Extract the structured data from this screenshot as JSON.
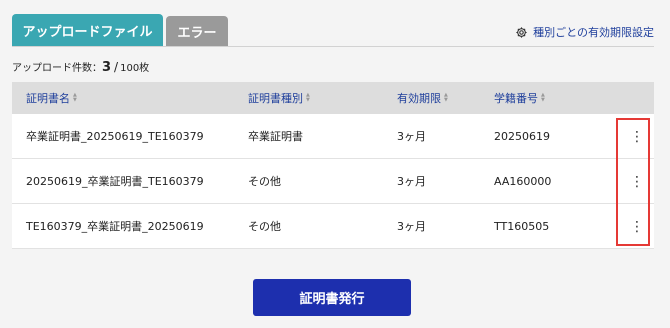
{
  "tabs": [
    {
      "label": "アップロードファイル",
      "active": true
    },
    {
      "label": "エラー",
      "active": false
    }
  ],
  "settings_link": {
    "label": "種別ごとの有効期限設定",
    "icon": "gear-icon"
  },
  "upload_count": {
    "label": "アップロード件数：",
    "current": "3",
    "separator": "/",
    "max": "100枚"
  },
  "table": {
    "headers": [
      "証明書名",
      "証明書種別",
      "有効期限",
      "学籍番号"
    ],
    "rows": [
      {
        "name": "卒業証明書_20250619_TE160379",
        "type": "卒業証明書",
        "validity": "3ヶ月",
        "student_id": "20250619",
        "menu": "⋮"
      },
      {
        "name": "20250619_卒業証明書_TE160379",
        "type": "その他",
        "validity": "3ヶ月",
        "student_id": "AA160000",
        "menu": "⋮"
      },
      {
        "name": "TE160379_卒業証明書_20250619",
        "type": "その他",
        "validity": "3ヶ月",
        "student_id": "TT160505",
        "menu": "⋮"
      }
    ]
  },
  "issue_button": {
    "label": "証明書発行"
  },
  "colors": {
    "tab_active": "#3aa7b2",
    "tab_inactive": "#9a9a9a",
    "primary_button": "#1d2fae",
    "link": "#1f3f9c",
    "highlight": "#e53935"
  }
}
